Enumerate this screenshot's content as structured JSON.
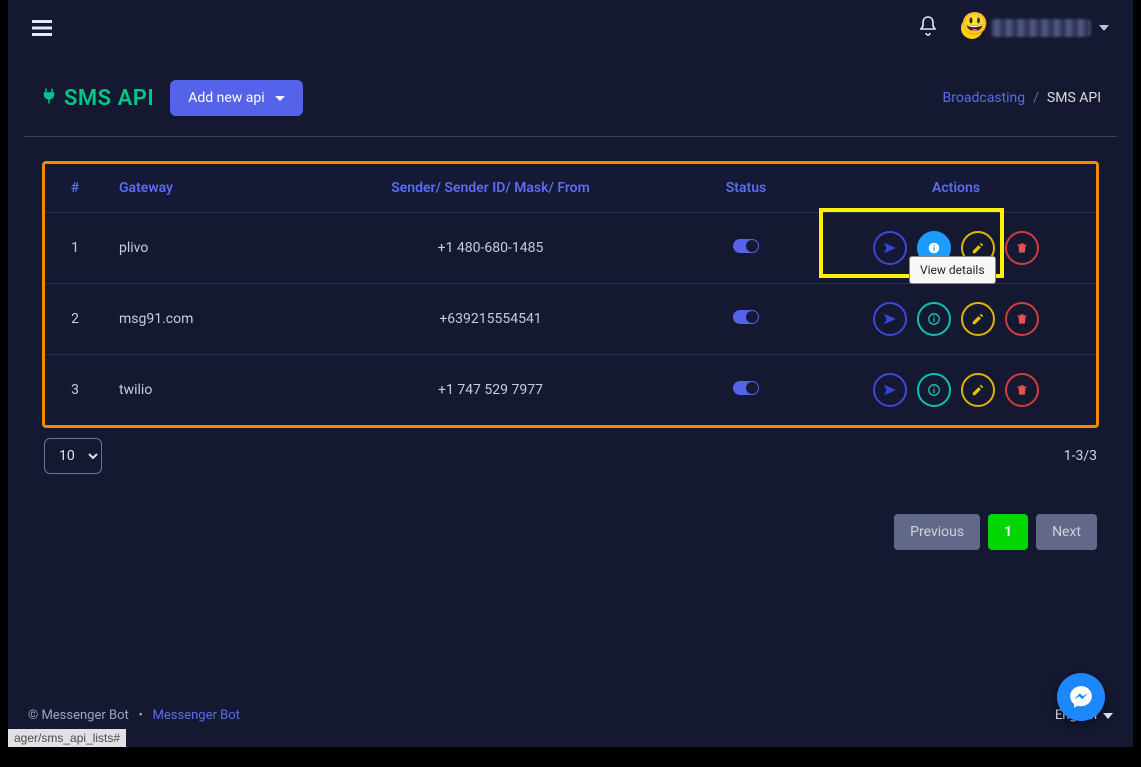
{
  "header": {
    "app_title": "SMS API",
    "add_button": "Add new api",
    "breadcrumb_parent": "Broadcasting",
    "breadcrumb_current": "SMS API"
  },
  "table": {
    "columns": {
      "index": "#",
      "gateway": "Gateway",
      "sender": "Sender/ Sender ID/ Mask/ From",
      "status": "Status",
      "actions": "Actions"
    },
    "rows": [
      {
        "index": "1",
        "gateway": "plivo",
        "sender": "+1 480-680-1485",
        "status_on": true
      },
      {
        "index": "2",
        "gateway": "msg91.com",
        "sender": "+639215554541",
        "status_on": true
      },
      {
        "index": "3",
        "gateway": "twilio",
        "sender": "+1 747 529 7977",
        "status_on": true
      }
    ]
  },
  "tooltip_view_details": "View details",
  "below": {
    "per_page_selected": "10",
    "counter": "1-3/3"
  },
  "pagination": {
    "previous": "Previous",
    "page": "1",
    "next": "Next"
  },
  "footer": {
    "copyright": "© Messenger Bot",
    "dot": "•",
    "link": "Messenger Bot",
    "language": "English"
  },
  "status_strip": "ager/sms_api_lists#"
}
